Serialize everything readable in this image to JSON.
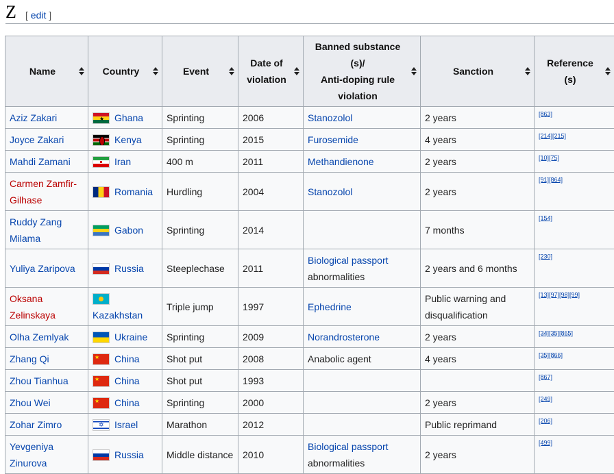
{
  "section": {
    "letter": "Z",
    "edit_open": "[ ",
    "edit_label": "edit",
    "edit_close": " ]"
  },
  "columns": [
    "Name",
    "Country",
    "Event",
    "Date of violation",
    "Banned substance (s)/ Anti-doping rule violation",
    "Sanction",
    "Reference (s)"
  ],
  "column_lines": {
    "date": [
      "Date of",
      "violation"
    ],
    "substance": [
      "Banned substance",
      "(s)/",
      "Anti-doping rule",
      "violation"
    ],
    "reference": [
      "Reference",
      "(s)"
    ]
  },
  "rows": [
    {
      "name": "Aziz Zakari",
      "name_link": "blue",
      "flag": "ghana-flag-icon",
      "country": "Ghana",
      "event": "Sprinting",
      "date": "2006",
      "substance": "Stanozolol",
      "substance_link": true,
      "sanction": "2 years",
      "refs": "[863]"
    },
    {
      "name": "Joyce Zakari",
      "name_link": "blue",
      "flag": "kenya-flag-icon",
      "country": "Kenya",
      "event": "Sprinting",
      "date": "2015",
      "substance": "Furosemide",
      "substance_link": true,
      "sanction": "4 years",
      "refs": "[214][215]"
    },
    {
      "name": "Mahdi Zamani",
      "name_link": "blue",
      "flag": "iran-flag-icon",
      "country": "Iran",
      "event": "400 m",
      "date": "2011",
      "substance": "Methandienone",
      "substance_link": true,
      "sanction": "2 years",
      "refs": "[10][75]"
    },
    {
      "name": "Carmen Zamfir-Gilhase",
      "name_link": "red",
      "flag": "romania-flag-icon",
      "country": "Romania",
      "event": "Hurdling",
      "date": "2004",
      "substance": "Stanozolol",
      "substance_link": true,
      "sanction": "2 years",
      "refs": "[91][864]"
    },
    {
      "name": "Ruddy Zang Milama",
      "name_link": "blue",
      "flag": "gabon-flag-icon",
      "country": "Gabon",
      "event": "Sprinting",
      "date": "2014",
      "substance": "",
      "substance_link": false,
      "sanction": "7 months",
      "refs": "[154]"
    },
    {
      "name": "Yuliya Zaripova",
      "name_link": "blue",
      "flag": "russia-flag-icon",
      "country": "Russia",
      "event": "Steeplechase",
      "date": "2011",
      "substance": "Biological passport",
      "substance_extra": "abnormalities",
      "substance_link": true,
      "sanction": "2 years and 6 months",
      "refs": "[230]"
    },
    {
      "name": "Oksana Zelinskaya",
      "name_link": "red",
      "flag": "kazakhstan-flag-icon",
      "country": "Kazakhstan",
      "event": "Triple jump",
      "date": "1997",
      "substance": "Ephedrine",
      "substance_link": true,
      "sanction": "Public warning and disqualification",
      "refs": "[13][97][98][99]"
    },
    {
      "name": "Olha Zemlyak",
      "name_link": "blue",
      "flag": "ukraine-flag-icon",
      "country": "Ukraine",
      "event": "Sprinting",
      "date": "2009",
      "substance": "Norandrosterone",
      "substance_link": true,
      "sanction": "2 years",
      "refs": "[34][35][865]"
    },
    {
      "name": "Zhang Qi",
      "name_link": "blue",
      "flag": "china-flag-icon",
      "country": "China",
      "event": "Shot put",
      "date": "2008",
      "substance": "Anabolic agent",
      "substance_link": false,
      "sanction": "4 years",
      "refs": "[35][866]"
    },
    {
      "name": "Zhou Tianhua",
      "name_link": "blue",
      "flag": "china-flag-icon",
      "country": "China",
      "event": "Shot put",
      "date": "1993",
      "substance": "",
      "substance_link": false,
      "sanction": "",
      "refs": "[867]"
    },
    {
      "name": "Zhou Wei",
      "name_link": "blue",
      "flag": "china-flag-icon",
      "country": "China",
      "event": "Sprinting",
      "date": "2000",
      "substance": "",
      "substance_link": false,
      "sanction": "2 years",
      "refs": "[249]"
    },
    {
      "name": "Zohar Zimro",
      "name_link": "blue",
      "flag": "israel-flag-icon",
      "country": "Israel",
      "event": "Marathon",
      "date": "2012",
      "substance": "",
      "substance_link": false,
      "sanction": "Public reprimand",
      "refs": "[206]"
    },
    {
      "name": "Yevgeniya Zinurova",
      "name_link": "blue",
      "flag": "russia-flag-icon",
      "country": "Russia",
      "event": "Middle distance",
      "date": "2010",
      "substance": "Biological passport",
      "substance_extra": "abnormalities",
      "substance_link": true,
      "sanction": "2 years",
      "refs": "[499]"
    }
  ],
  "colors": {
    "link": "#0645ad",
    "redlink": "#ba0000",
    "header_bg": "#eaecf0",
    "cell_bg": "#f8f9fa",
    "border": "#a2a9b1"
  }
}
